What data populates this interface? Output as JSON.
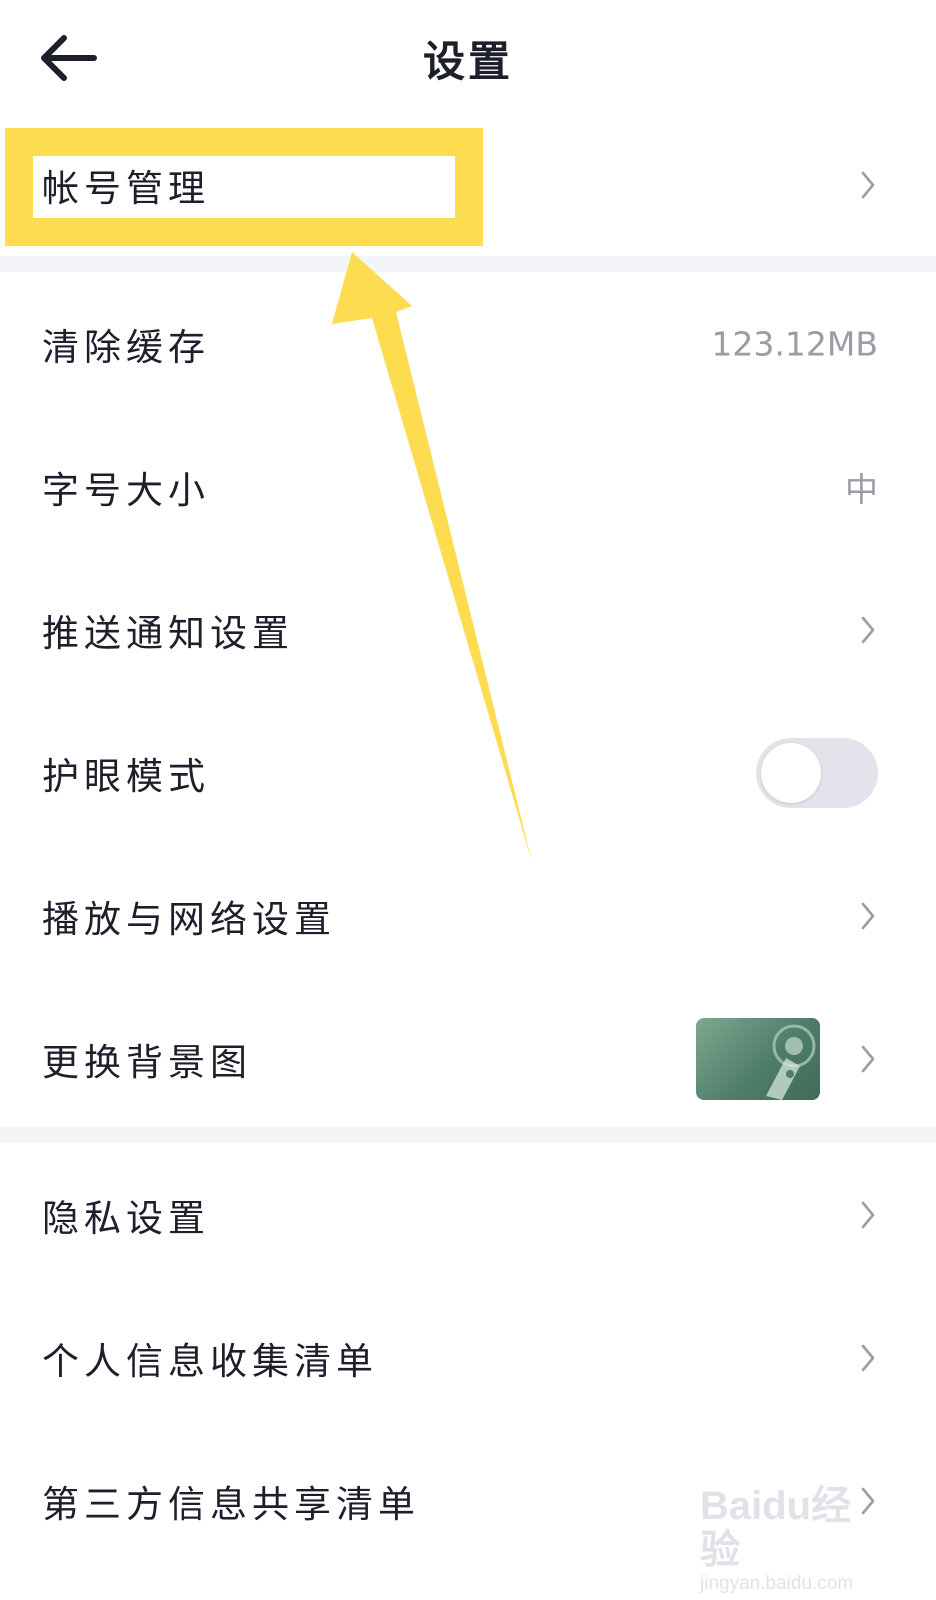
{
  "header": {
    "title": "设置",
    "back_icon": "arrow-left-icon"
  },
  "settings": {
    "account": {
      "label": "帐号管理"
    },
    "clear_cache": {
      "label": "清除缓存",
      "value": "123.12MB"
    },
    "font_size": {
      "label": "字号大小",
      "value": "中"
    },
    "push_notifications": {
      "label": "推送通知设置"
    },
    "eye_protection": {
      "label": "护眼模式",
      "toggle_on": false
    },
    "playback_network": {
      "label": "播放与网络设置"
    },
    "background": {
      "label": "更换背景图"
    },
    "privacy": {
      "label": "隐私设置"
    },
    "personal_info_list": {
      "label": "个人信息收集清单"
    },
    "third_party_list": {
      "label": "第三方信息共享清单"
    }
  },
  "colors": {
    "highlight": "#fddc50",
    "divider": "#f4f5f9",
    "toggle_off": "#e2e3eb",
    "secondary_text": "#9a9ca6"
  },
  "watermark": {
    "logo": "Baidu经验",
    "url": "jingyan.baidu.com"
  }
}
